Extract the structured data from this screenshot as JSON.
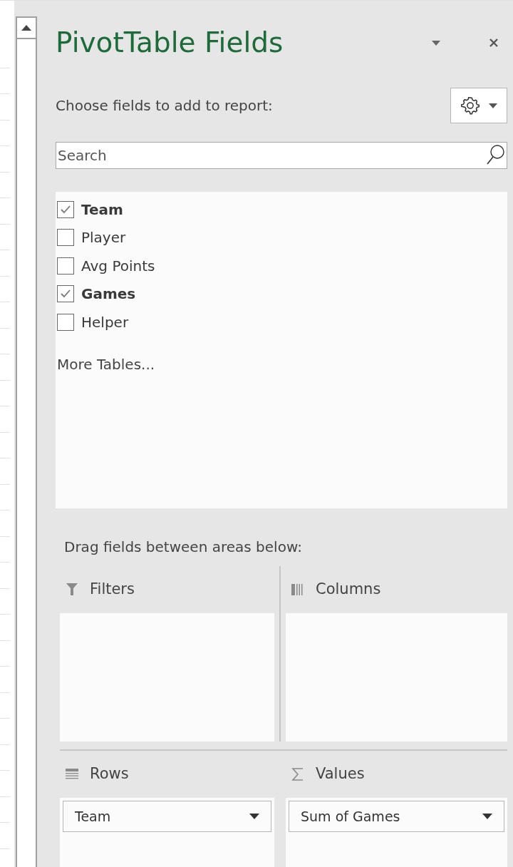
{
  "panel": {
    "title": "PivotTable Fields",
    "prompt": "Choose fields to add to report:"
  },
  "search": {
    "placeholder": "Search"
  },
  "fields": [
    {
      "label": "Team",
      "checked": true
    },
    {
      "label": "Player",
      "checked": false
    },
    {
      "label": "Avg Points",
      "checked": false
    },
    {
      "label": "Games",
      "checked": true
    },
    {
      "label": "Helper",
      "checked": false
    }
  ],
  "more_tables": "More Tables...",
  "areas_prompt": "Drag fields between areas below:",
  "areas": [
    {
      "kind": "filters",
      "label": "Filters"
    },
    {
      "kind": "columns",
      "label": "Columns"
    },
    {
      "kind": "rows",
      "label": "Rows",
      "items": [
        "Team"
      ]
    },
    {
      "kind": "values",
      "label": "Values",
      "items": [
        "Sum of Games"
      ]
    }
  ]
}
